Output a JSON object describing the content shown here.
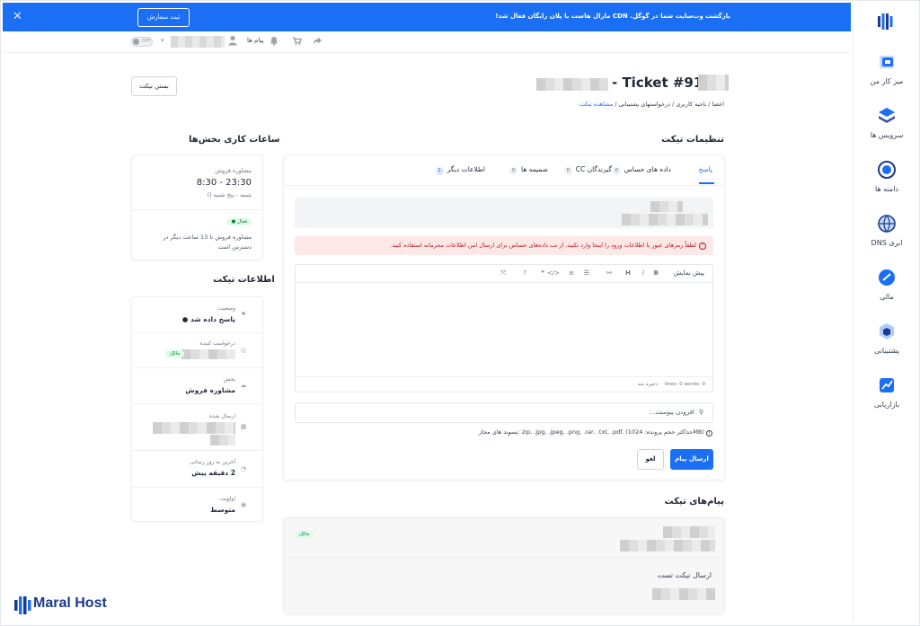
{
  "banner": {
    "text": "بازگشت وب‌سایت شما در گوگل. CDN مارال هاست با پلان رایگان فعال شد!",
    "button": "ثبت سفارش"
  },
  "toolbar": {
    "messages": "پیام ها",
    "toggle": "OFF"
  },
  "sidebar": {
    "items": [
      {
        "label": "میز کار من",
        "icon": "dashboard-icon"
      },
      {
        "label": "سرویس ها",
        "icon": "services-icon"
      },
      {
        "label": "دامنه ها",
        "icon": "domains-icon"
      },
      {
        "label": "DNS ابری",
        "icon": "cloud-dns-icon"
      },
      {
        "label": "مالی",
        "icon": "billing-icon"
      },
      {
        "label": "پشتیبانی",
        "icon": "support-icon"
      },
      {
        "label": "بازاریابی",
        "icon": "marketing-icon"
      }
    ]
  },
  "page": {
    "title": "- Ticket #914",
    "close_button": "بستن تیکت",
    "breadcrumb": [
      "اعضا",
      "ناحیه کاربری",
      "درخواستهای پشتیبانی",
      "مشاهده تیکت"
    ]
  },
  "settings": {
    "heading": "تنظیمات تیکت",
    "tabs": [
      {
        "label": "پاسخ",
        "count": ""
      },
      {
        "label": "داده های حساس",
        "count": "0"
      },
      {
        "label": "گیرندگان CC",
        "count": "0"
      },
      {
        "label": "ضمیمه ها",
        "count": "0"
      },
      {
        "label": "اطلاعات دیگر",
        "count": "1"
      }
    ],
    "alert_text": "لطفاً رمزهای عبور یا اطلاعات ورود را اینجا وارد نکنید. از تب داده‌های حساس برای ارسال امن اطلاعات محرمانه استفاده کنید.",
    "editor_preview": "پیش نمایش",
    "editor_status": "lines: 0  words: 0",
    "editor_saved": "ذخیره شد",
    "attach_placeholder": "افزودن پیوست...",
    "allowed_ext": "پسوند های مجاز: zip, .jpg, .jpeg, .png, .rar, .txt, .pdf. (حداکثر حجم پرونده: 1024MB)",
    "send_button": "ارسال پیام",
    "cancel_button": "لغو"
  },
  "hours": {
    "heading": "ساعات کاری بخش‌ها",
    "dept": "مشاوره فروش",
    "time": "8:30 - 23:30",
    "days": "شنبه - پنج شنبه ()",
    "status_badge": "فعال",
    "availability": "مشاوره فروش تا 13 ساعت دیگر در دسترس است"
  },
  "ticket_info": {
    "heading": "اطلاعات تیکت",
    "rows": [
      {
        "label": "وضعیت:",
        "value": "پاسخ داده شد"
      },
      {
        "label": "درخواست کننده",
        "value": "",
        "badge": "مالک"
      },
      {
        "label": "بخش",
        "value": "مشاوره فروش"
      },
      {
        "label": "ارسال شده",
        "value": ""
      },
      {
        "label": "آخرین به روز رسانی",
        "value": "2 دقیقه پیش"
      },
      {
        "label": "اولویت",
        "value": "متوسط"
      }
    ]
  },
  "messages": {
    "heading": "پیام‌های تیکت",
    "owner_badge": "مالک",
    "body": "ارسال تیکت تست"
  },
  "brand": {
    "name": "Maral Host",
    "color": "#1b6ff5"
  }
}
